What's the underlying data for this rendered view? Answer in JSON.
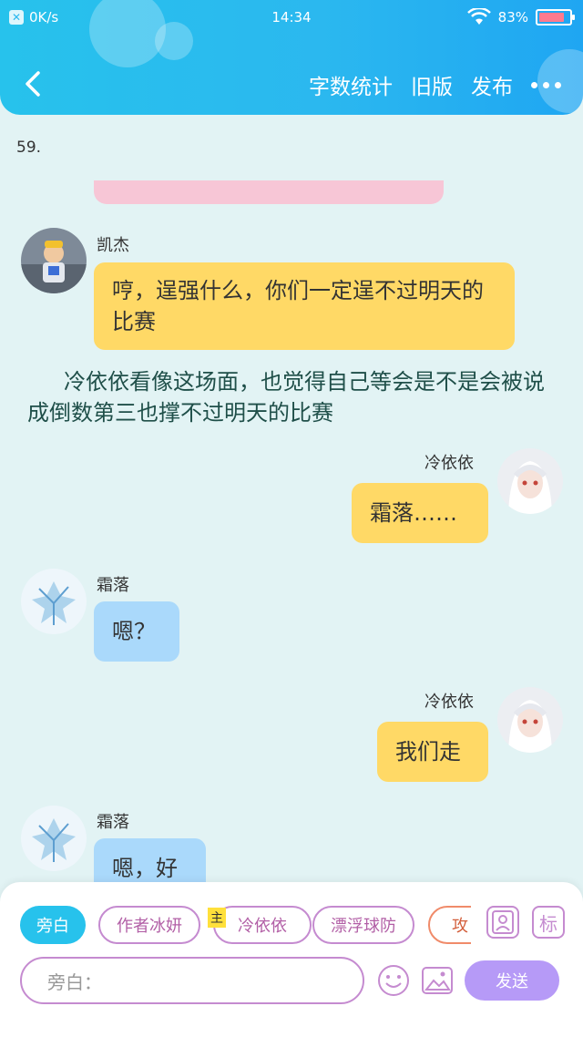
{
  "status_bar": {
    "speed": "0K/s",
    "time": "14:34",
    "battery": "83%",
    "battery_level": 0.83
  },
  "nav": {
    "actions": [
      "字数统计",
      "旧版",
      "发布"
    ]
  },
  "chapter": {
    "number": "59."
  },
  "messages": [
    {
      "speaker": "凯杰",
      "side": "left",
      "text": "哼，逞强什么，你们一定逞不过明天的比赛",
      "color": "#ffd966"
    },
    {
      "speaker": "冷依依",
      "side": "right",
      "text": "霜落……",
      "color": "#ffd966"
    },
    {
      "speaker": "霜落",
      "side": "left",
      "text": "嗯？",
      "color": "#aad9fb"
    },
    {
      "speaker": "冷依依",
      "side": "right",
      "text": "我们走",
      "color": "#ffd966"
    },
    {
      "speaker": "霜落",
      "side": "left",
      "text": "嗯，好",
      "color": "#aad9fb"
    }
  ],
  "narration": "冷依依看像这场面，也觉得自己等会是不是会被说成倒数第三也撑不过明天的比赛",
  "roles": [
    {
      "label": "旁白",
      "active": true
    },
    {
      "label": "作者冰妍",
      "active": false
    },
    {
      "label": "冷依依",
      "active": false,
      "badge": "主"
    },
    {
      "label": "漂浮球防",
      "active": false
    },
    {
      "label": "攻",
      "active": false
    }
  ],
  "input": {
    "placeholder": "旁白："
  },
  "send_label": "发送",
  "tag_icon_label": "标"
}
